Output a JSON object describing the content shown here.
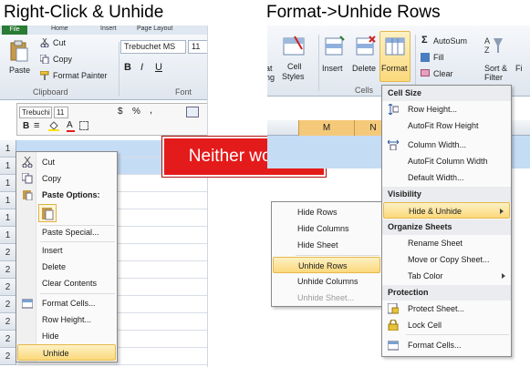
{
  "titles": {
    "left": "Right-Click & Unhide",
    "right": "Format->Unhide Rows"
  },
  "left_ribbon": {
    "tab_file": "File",
    "tab_home": "Home",
    "tab_insert": "Insert",
    "tab_page_layout": "Page Layout",
    "paste": "Paste",
    "cut": "Cut",
    "copy": "Copy",
    "format_painter": "Format Painter",
    "clipboard": "Clipboard",
    "font_name": "Trebuchet MS",
    "font_size": "11",
    "font_group": "Font",
    "bold": "B",
    "italic": "I",
    "underline": "U"
  },
  "mini_toolbar": {
    "font": "Trebuchi",
    "size": "11",
    "bold": "B",
    "align": "≡",
    "dollar": "$",
    "percent": "%",
    "comma": ","
  },
  "row_numbers": [
    "1",
    "1",
    "1",
    "1",
    "1",
    "1",
    "2",
    "2",
    "2",
    "2",
    "2",
    "2",
    "2"
  ],
  "context_menu": {
    "items": [
      "Cut",
      "Copy",
      "Paste Options:",
      "Paste Special...",
      "Insert",
      "Delete",
      "Clear Contents",
      "Format Cells...",
      "Row Height...",
      "Hide",
      "Unhide"
    ]
  },
  "callout": "Neither works!",
  "right_ribbon": {
    "format_partial": "at",
    "format_partial2": "ng",
    "cell_styles_1": "Cell",
    "cell_styles_2": "Styles",
    "insert": "Insert",
    "delete": "Delete",
    "format": "Format",
    "cells": "Cells",
    "autosum": "AutoSum",
    "fill": "Fill",
    "clear": "Clear",
    "sort_1": "Sort &",
    "sort_2": "Filter",
    "find": "Fi",
    "col_m": "M",
    "col_n": "N"
  },
  "hide_submenu": [
    "Hide Rows",
    "Hide Columns",
    "Hide Sheet",
    "Unhide Rows",
    "Unhide Columns",
    "Unhide Sheet..."
  ],
  "format_menu": {
    "cell_size": "Cell Size",
    "row_height": "Row Height...",
    "autofit_row": "AutoFit Row Height",
    "column_width": "Column Width...",
    "autofit_column": "AutoFit Column Width",
    "default_width": "Default Width...",
    "visibility": "Visibility",
    "hide_unhide": "Hide & Unhide",
    "organize": "Organize Sheets",
    "rename": "Rename Sheet",
    "move_copy": "Move or Copy Sheet...",
    "tab_color": "Tab Color",
    "protection": "Protection",
    "protect": "Protect Sheet...",
    "lock": "Lock Cell",
    "format_cells": "Format Cells..."
  },
  "colors": {
    "accent": "#e41b1b",
    "highlight": "#fbd97c",
    "selection": "#c5dcf5"
  }
}
